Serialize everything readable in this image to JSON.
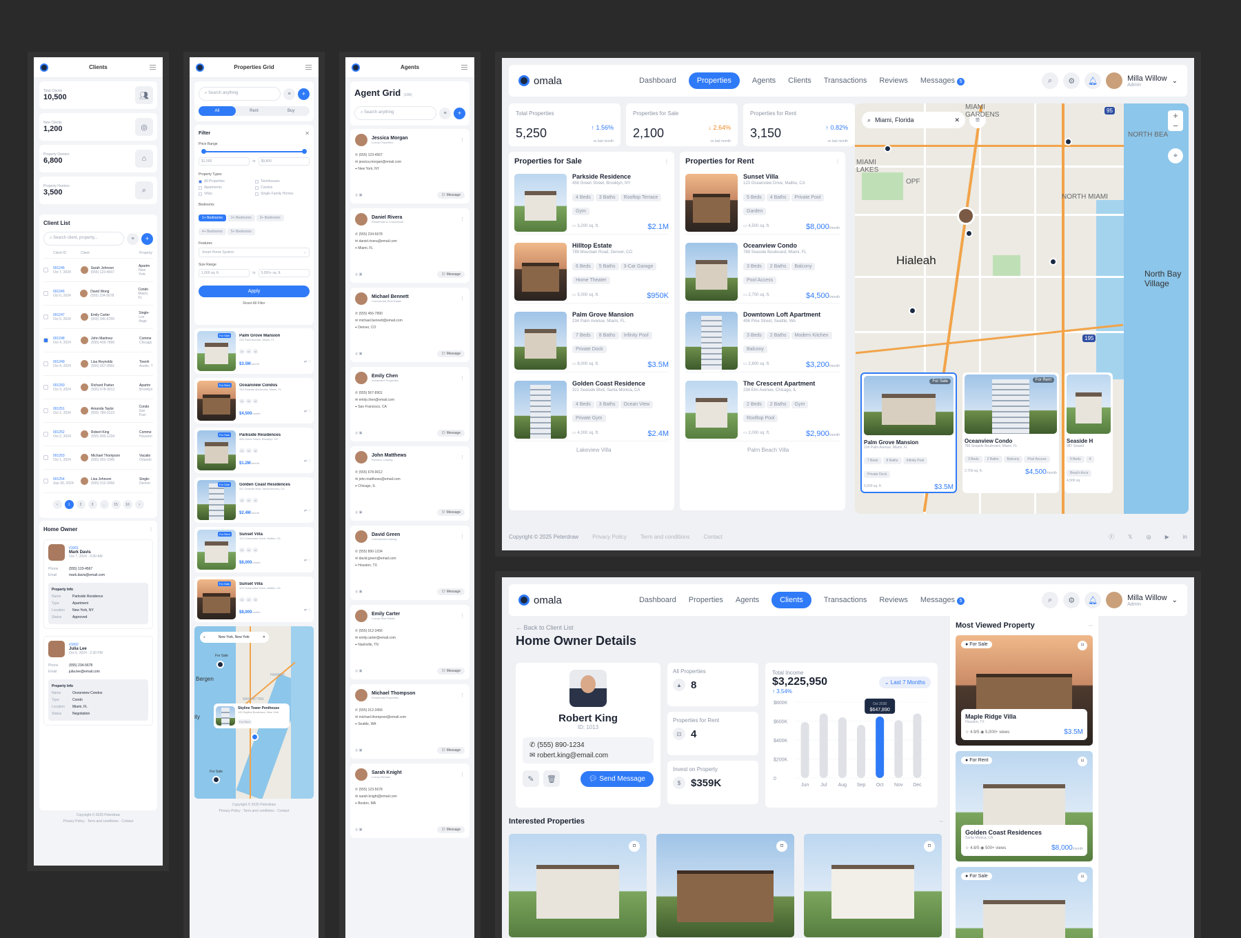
{
  "brand": {
    "name": "omala"
  },
  "nav": {
    "items": [
      "Dashboard",
      "Properties",
      "Agents",
      "Clients",
      "Transactions",
      "Reviews",
      "Messages"
    ],
    "messages_badge": "5"
  },
  "user": {
    "name": "Milla Willow",
    "role": "Admin"
  },
  "clients_mobile": {
    "title": "Clients",
    "stats": [
      {
        "label": "Total Clients",
        "value": "10,500"
      },
      {
        "label": "New Clients",
        "value": "1,200"
      },
      {
        "label": "Property Owners",
        "value": "6,800"
      },
      {
        "label": "Property Hunters",
        "value": "3,500"
      }
    ],
    "list_title": "Client List",
    "search_placeholder": "Search client, property...",
    "columns": [
      "Client ID",
      "Client",
      "Property"
    ],
    "rows": [
      {
        "id": "001245",
        "date": "Oct 7, 2024",
        "name": "Sarah Johnson",
        "phone": "(555) 123-4567",
        "prop": "Apartm",
        "loc": "New York"
      },
      {
        "id": "001246",
        "date": "Oct 6, 2024",
        "name": "David Wong",
        "phone": "(555) 234-5678",
        "prop": "Condo",
        "loc": "Miami, FL"
      },
      {
        "id": "001247",
        "date": "Oct 5, 2024",
        "name": "Emily Carter",
        "phone": "(555) 345-6789",
        "prop": "Single-",
        "loc": "Los Ange"
      },
      {
        "id": "001248",
        "date": "Oct 4, 2024",
        "name": "John Martinez",
        "phone": "(555) 456-7890",
        "prop": "Comme",
        "loc": "Chicago"
      },
      {
        "id": "001249",
        "date": "Oct 4, 2024",
        "name": "Lisa Reynolds",
        "phone": "(555) 567-8901",
        "prop": "Townh",
        "loc": "Austin, T"
      },
      {
        "id": "001250",
        "date": "Oct 3, 2024",
        "name": "Richard Parker",
        "phone": "(555) 678-9012",
        "prop": "Apartm",
        "loc": "Brooklyn"
      },
      {
        "id": "001251",
        "date": "Oct 2, 2024",
        "name": "Amanda Taylor",
        "phone": "(555) 789-0123",
        "prop": "Condo",
        "loc": "San Fran"
      },
      {
        "id": "001252",
        "date": "Oct 2, 2024",
        "name": "Robert King",
        "phone": "(555) 890-1234",
        "prop": "Comme",
        "loc": "Houston"
      },
      {
        "id": "001253",
        "date": "Oct 1, 2024",
        "name": "Michael Thompson",
        "phone": "(555) 901-2345",
        "prop": "Vacatio",
        "loc": "Orlando"
      },
      {
        "id": "001254",
        "date": "Sep 30, 2024",
        "name": "Lisa Johnson",
        "phone": "(555) 012-3456",
        "prop": "Single-",
        "loc": "Denver"
      }
    ],
    "pages": [
      "1",
      "2",
      "3",
      "...",
      "15",
      "16"
    ],
    "owner_title": "Home Owner",
    "owners": [
      {
        "id": "#1001",
        "name": "Mark Davis",
        "date": "Oct 7, 2024 - 9:00 AM",
        "phone": "(555) 123-4567",
        "email": "mark.davis@email.com",
        "prop_name": "Parkside Residence",
        "type": "Apartment",
        "location": "New York, NY",
        "status": "Approved"
      },
      {
        "id": "#1002",
        "name": "Julia Lee",
        "date": "Oct 6, 2024 - 2:30 PM",
        "phone": "(555) 234-5678",
        "email": "julia.lee@email.com",
        "prop_name": "Oceanview Condos",
        "type": "Condo",
        "location": "Miami, FL",
        "status": "Negotiation"
      }
    ],
    "labels": {
      "phone": "Phone",
      "email": "Email",
      "prop_info": "Property Info",
      "name": "Name",
      "type": "Type",
      "location": "Location",
      "status": "Status"
    },
    "footer": "Copyright © 2025 Peterdraw",
    "footer_links": [
      "Privacy Policy",
      "Term and conditions",
      "Contact"
    ]
  },
  "grid_mobile": {
    "title": "Properties Grid",
    "search_placeholder": "Search anything",
    "tabs": [
      "All",
      "Rent",
      "Buy"
    ],
    "filter_title": "Filter",
    "price_label": "Price Range",
    "price_min": "$1,000",
    "price_to": "to",
    "price_max": "$9,800",
    "types_label": "Property Types",
    "types": [
      "All Properties",
      "Townhouses",
      "Apartments",
      "Condos",
      "Villas",
      "Single-Family Homes"
    ],
    "bedrooms_label": "Bedrooms",
    "bedrooms": [
      "1+ Bedrooms",
      "2+ Bedrooms",
      "3+ Bedrooms",
      "4+ Bedrooms",
      "5+ Bedrooms"
    ],
    "features_label": "Features",
    "features_value": "Smart Home System",
    "size_label": "Size Range",
    "size_min": "1,000 sq. ft.",
    "size_max": "5,000+ sq. ft.",
    "apply": "Apply",
    "reset": "Reset All Filter",
    "cards": [
      {
        "tag": "For Sale",
        "name": "Palm Grove Mansion",
        "addr": "234 Palm Avenue, Miami, FL",
        "price": "$3.5M",
        "unit": "/month"
      },
      {
        "tag": "For Rent",
        "name": "Oceanview Condos",
        "addr": "789 Seaside Boulevard, Miami, FL",
        "price": "$4,500",
        "unit": "/month"
      },
      {
        "tag": "For Sale",
        "name": "Parkside Residences",
        "addr": "456 Green Street, Brooklyn, NY",
        "price": "$1.2M",
        "unit": "/month"
      },
      {
        "tag": "For Sale",
        "name": "Golden Coast Residences",
        "addr": "321 Seaside Blvd, Santa Monica, CA",
        "price": "$2.4M",
        "unit": "/month"
      },
      {
        "tag": "For Rent",
        "name": "Sunset Villa",
        "addr": "123 Oceanview Drive, Malibu, CA",
        "price": "$8,000",
        "unit": "/month"
      },
      {
        "tag": "For Sale",
        "name": "Sunset Villa",
        "addr": "123 Oceanview Drive, Malibu, CA",
        "price": "$8,000",
        "unit": "/month"
      }
    ],
    "map_search": "New York, New York",
    "map_card": {
      "name": "Skyline Tower Penthouse",
      "addr": "120 Skyline Boulevard, New York",
      "tag": "For Rent"
    },
    "map_labels": [
      "Bergen",
      "HARLEM",
      "MANHATTAN",
      "For Sale",
      "For Sale",
      "ity"
    ],
    "footer": "Copyright © 2025 Peterdraw",
    "footer_links": [
      "Privacy Policy",
      "Term and conditions",
      "Contact"
    ]
  },
  "agents_mobile": {
    "title": "Agents",
    "heading": "Agent Grid",
    "count": "(189)",
    "search_placeholder": "Search anything",
    "message_label": "Message",
    "agents": [
      {
        "name": "Jessica Morgan",
        "role": "Luxury Properties",
        "phone": "(555) 123-4567",
        "email": "jessica.morgan@email.com",
        "city": "New York, NY"
      },
      {
        "name": "Daniel Rivera",
        "role": "Residential & Commercial",
        "phone": "(555) 234-5678",
        "email": "daniel.rivera@email.com",
        "city": "Miami, FL"
      },
      {
        "name": "Michael Bennett",
        "role": "Commercial Real Estate",
        "phone": "(555) 456-7890",
        "email": "michael.bennett@email.com",
        "city": "Denver, CO"
      },
      {
        "name": "Emily Chen",
        "role": "Investment Properties",
        "phone": "(555) 567-8901",
        "email": "emily.chen@email.com",
        "city": "San Francisco, CA"
      },
      {
        "name": "John Matthews",
        "role": "Rental & Leasing",
        "phone": "(555) 678-9012",
        "email": "john.matthews@email.com",
        "city": "Chicago, IL"
      },
      {
        "name": "David Green",
        "role": "Commercial Leasing",
        "phone": "(555) 890-1234",
        "email": "david.green@email.com",
        "city": "Houston, TX"
      },
      {
        "name": "Emily Carter",
        "role": "Luxury Real Estate",
        "phone": "(555) 012-3456",
        "email": "emily.carter@email.com",
        "city": "Nashville, TN"
      },
      {
        "name": "Michael Thompson",
        "role": "Residential Properties",
        "phone": "(555) 012-3456",
        "email": "michael.thompson@email.com",
        "city": "Seattle, WA"
      },
      {
        "name": "Sarah Knight",
        "role": "Luxury Rentals",
        "phone": "(555) 123-5678",
        "email": "sarah.knight@email.com",
        "city": "Boston, MA"
      }
    ]
  },
  "properties_page": {
    "stats": [
      {
        "label": "Total Properties",
        "value": "5,250",
        "change": "↑ 1.56%",
        "note": "vs last month",
        "dir": "up"
      },
      {
        "label": "Properties for Sale",
        "value": "2,100",
        "change": "↓ 2.64%",
        "note": "vs last month",
        "dir": "down"
      },
      {
        "label": "Properties for Rent",
        "value": "3,150",
        "change": "↑ 0.82%",
        "note": "vs last month",
        "dir": "up"
      }
    ],
    "sale_title": "Properties for Sale",
    "rent_title": "Properties for Rent",
    "sale": [
      {
        "name": "Parkside Residence",
        "addr": "456 Green Street, Brooklyn, NY",
        "tags": [
          "4 Beds",
          "3 Baths",
          "Rooftop Terrace",
          "Gym"
        ],
        "size": "3,200 sq. ft.",
        "price": "$2.1M"
      },
      {
        "name": "Hilltop Estate",
        "addr": "789 Mountain Road, Denver, CO",
        "tags": [
          "6 Beds",
          "5 Baths",
          "3-Car Garage",
          "Home Theater"
        ],
        "size": "5,000 sq. ft.",
        "price": "$950K"
      },
      {
        "name": "Palm Grove Mansion",
        "addr": "234 Palm Avenue, Miami, FL",
        "tags": [
          "7 Beds",
          "8 Baths",
          "Infinity Pool",
          "Private Dock"
        ],
        "size": "6,000 sq. ft.",
        "price": "$3.5M"
      },
      {
        "name": "Golden Coast Residence",
        "addr": "321 Seaside Blvd, Santa Monica, CA",
        "tags": [
          "4 Beds",
          "3 Baths",
          "Ocean View",
          "Private Gym"
        ],
        "size": "4,000 sq. ft.",
        "price": "$2.4M"
      }
    ],
    "sale_more": "Lakeview Villa",
    "rent": [
      {
        "name": "Sunset Villa",
        "addr": "123 Oceanview Drive, Malibu, CA",
        "tags": [
          "5 Beds",
          "4 Baths",
          "Private Pool",
          "Garden"
        ],
        "size": "4,500 sq. ft.",
        "price": "$8,000",
        "unit": "/month"
      },
      {
        "name": "Oceanview Condo",
        "addr": "789 Seaside Boulevard, Miami, FL",
        "tags": [
          "3 Beds",
          "2 Baths",
          "Balcony",
          "Pool Access"
        ],
        "size": "2,700 sq. ft.",
        "price": "$4,500",
        "unit": "/month"
      },
      {
        "name": "Downtown Loft Apartment",
        "addr": "456 Pine Street, Seattle, WA",
        "tags": [
          "3 Beds",
          "2 Baths",
          "Modern Kitchen",
          "Balcony"
        ],
        "size": "2,800 sq. ft.",
        "price": "$3,200",
        "unit": "/month"
      },
      {
        "name": "The Crescent Apartment",
        "addr": "234 Elm Avenue, Chicago, IL",
        "tags": [
          "2 Beds",
          "2 Baths",
          "Gym",
          "Rooftop Pool"
        ],
        "size": "2,000 sq. ft.",
        "price": "$2,900",
        "unit": "/month"
      }
    ],
    "rent_more": "Palm Beach Villa",
    "map_search": "Miami, Florida",
    "map_labels": [
      "Hialeah",
      "North Bay Village",
      "NORTH MIAMI",
      "NORTH BEA",
      "MIAMI LAKES",
      "OPF",
      "MIAMI GARDENS",
      "195",
      "95"
    ],
    "map_cards": [
      {
        "tag": "For Sale",
        "name": "Palm Grove Mansion",
        "addr": "234 Palm Avenue, Miami, FL",
        "tags": [
          "7 Beds",
          "8 Baths",
          "Infinity Pool",
          "Private Dock"
        ],
        "size": "6,000 sq. ft.",
        "price": "$3.5M",
        "unit": ""
      },
      {
        "tag": "For Rent",
        "name": "Oceanview Condo",
        "addr": "789 Seaside Boulevard, Miami, FL",
        "tags": [
          "3 Beds",
          "2 Baths",
          "Balcony",
          "Pool Access"
        ],
        "size": "2,700 sq. ft.",
        "price": "$4,500",
        "unit": "/month"
      },
      {
        "tag": "",
        "name": "Seaside H",
        "addr": "987 Seasid",
        "tags": [
          "5 Beds",
          "4",
          "Beach Acce"
        ],
        "size": "4,500 sq.",
        "price": "",
        "unit": ""
      }
    ],
    "footer": "Copyright © 2025 Peterdraw",
    "footer_links": [
      "Privacy Policy",
      "Term and conditions",
      "Contact"
    ]
  },
  "owner_page": {
    "back": "Back to Client List",
    "title": "Home Owner Details",
    "name": "Robert King",
    "id_label": "ID: 1013",
    "phone": "(555) 890-1234",
    "email": "robert.king@email.com",
    "send": "Send Message",
    "stats": [
      {
        "label": "All Properties",
        "value": "8"
      },
      {
        "label": "Properties for Rent",
        "value": "4"
      },
      {
        "label": "Invest on Property",
        "value": "$359K"
      }
    ],
    "income_label": "Total Income",
    "income_value": "$3,225,950",
    "income_change": "↑ 3.54%",
    "range_button": "Last 7 Months",
    "tooltip_label": "Oct 2030",
    "tooltip_value": "$647,890",
    "interested_title": "Interested Properties",
    "most_viewed_title": "Most Viewed Property",
    "most_viewed": [
      {
        "tag": "For Sale",
        "name": "Maple Ridge Villa",
        "addr": "Houston, TX",
        "rating": "4.9/5",
        "views": "5,000+ views",
        "price": "$3.5M",
        "unit": ""
      },
      {
        "tag": "For Rent",
        "name": "Golden Coast Residences",
        "addr": "Santa Monica, CA",
        "rating": "4.8/5",
        "views": "500+ views",
        "price": "$8,000",
        "unit": "/month"
      },
      {
        "tag": "For Sale",
        "name": "",
        "addr": "",
        "rating": "",
        "views": "",
        "price": "",
        "unit": ""
      }
    ]
  },
  "chart_data": {
    "type": "bar",
    "categories": [
      "Jun",
      "Jul",
      "Aug",
      "Sep",
      "Oct",
      "Nov",
      "Dec"
    ],
    "values": [
      590000,
      680000,
      640000,
      560000,
      647890,
      610000,
      680000
    ],
    "highlight": "Oct",
    "ylim": [
      0,
      800000
    ],
    "yticks": [
      "$800K",
      "$600K",
      "$400K",
      "$200K",
      "0"
    ],
    "title": "Total Income",
    "colors": {
      "bar": "#dfe1e6",
      "highlight": "#2f7af7"
    }
  }
}
